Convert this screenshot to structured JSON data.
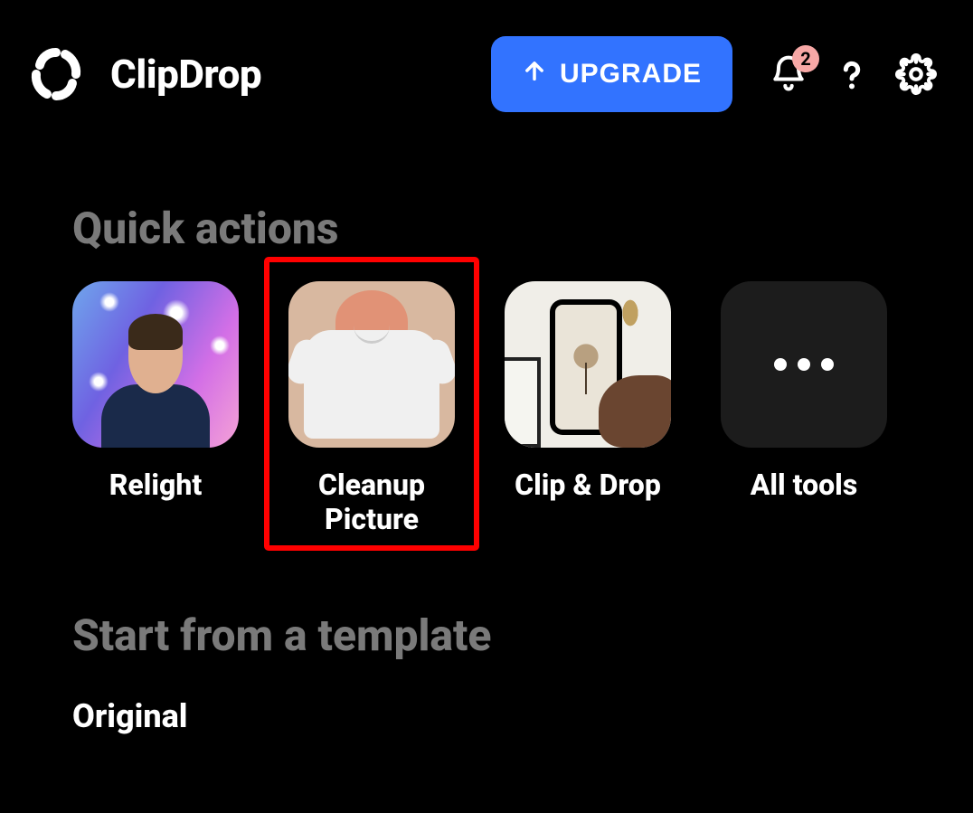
{
  "header": {
    "app_title": "ClipDrop",
    "upgrade_label": "UPGRADE",
    "notification_count": "2"
  },
  "sections": {
    "quick_actions_title": "Quick actions",
    "template_title": "Start from a template",
    "template_item_label": "Original"
  },
  "actions": [
    {
      "label": "Relight"
    },
    {
      "label": "Cleanup Picture"
    },
    {
      "label": "Clip & Drop"
    },
    {
      "label": "All tools"
    }
  ]
}
